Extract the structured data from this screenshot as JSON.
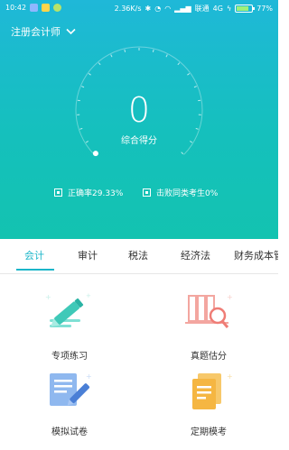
{
  "statusbar": {
    "time": "10:42",
    "speed": "2.36K/s",
    "carrier": "联通",
    "network": "4G",
    "battery_percent": 77,
    "battery_text": "77%"
  },
  "header": {
    "exam_name": "注册会计师"
  },
  "score": {
    "value": "0",
    "label": "综合得分"
  },
  "stats": {
    "accuracy": "正确率29.33%",
    "beat": "击败同类考生0%"
  },
  "tabs": [
    "会计",
    "审计",
    "税法",
    "经济法",
    "财务成本管理"
  ],
  "active_tab_index": 0,
  "features": [
    {
      "label": "专项练习",
      "icon": "pencil-practice-icon"
    },
    {
      "label": "真题估分",
      "icon": "books-magnifier-icon"
    },
    {
      "label": "模拟试卷",
      "icon": "paper-pen-icon"
    },
    {
      "label": "定期模考",
      "icon": "documents-icon"
    }
  ],
  "colors": {
    "hero_top": "#1fb8d8",
    "hero_bottom": "#13c3b0",
    "accent": "#1bb6c9"
  }
}
